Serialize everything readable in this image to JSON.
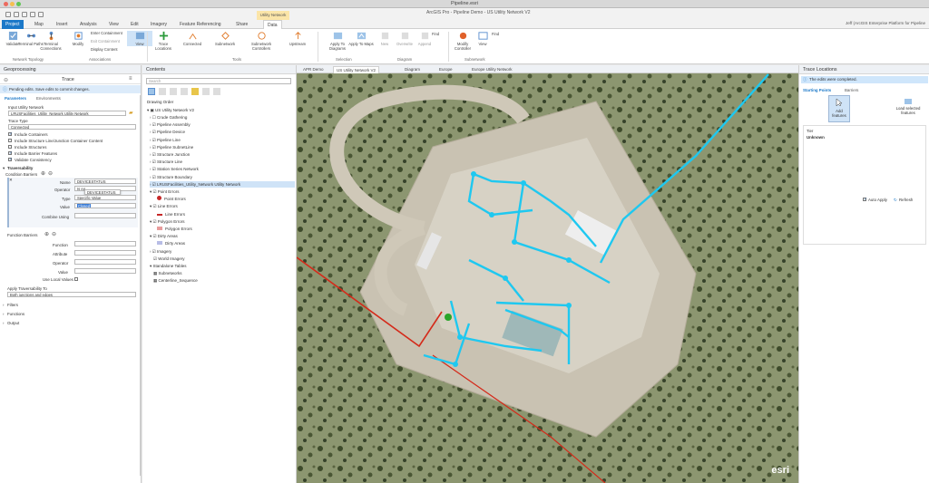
{
  "window": {
    "title": "Pipeline.esri",
    "app_center": "ArcGIS Pro - Pipeline Demo - US Utility Network V2",
    "context_tab_group": "Utility Network",
    "user": "Jeff (ArcGIS Enterprise Platform for Pipeline"
  },
  "ribbon": {
    "tabs": [
      "Project",
      "Map",
      "Insert",
      "Analysis",
      "View",
      "Edit",
      "Imagery",
      "Feature Referencing",
      "Share",
      "Data"
    ],
    "active_tab": "Data",
    "buttons": {
      "validate": "Validate",
      "terminal_paths": "Terminal Paths",
      "terminal_connections": "Terminal Connections",
      "modify": "Modify",
      "enter_containment": "Enter Containment",
      "exit_containment": "Exit Containment",
      "display_content": "Display Content",
      "view": "View",
      "trace_locations": "Trace Locations",
      "connected": "Connected",
      "subnetwork": "Subnetwork",
      "subnetwork_controllers": "Subnetwork Controllers",
      "upstream": "Upstream",
      "apply_to_diagrams": "Apply To Diagrams",
      "apply_to_maps": "Apply To Maps",
      "new": "New",
      "overwrite": "Overwrite",
      "append": "Append",
      "find_selection": "Find",
      "modify_controller": "Modify Controller",
      "view_subnetwork": "View",
      "find_subnetwork": "Find"
    },
    "groups": [
      "Network Topology",
      "Associations",
      "Tools",
      "Selection",
      "Diagram",
      "Subnetwork"
    ]
  },
  "geoprocessing": {
    "pane_title": "Geoprocessing",
    "tool_title": "Trace",
    "warning": "Pending edits. Save edits to commit changes.",
    "subtabs": [
      "Parameters",
      "Environments"
    ],
    "input_label": "Input Utility Network",
    "input_value": "LRUSFacilities_Utility_Network Utility Network",
    "trace_type_label": "Trace Type",
    "trace_type_value": "Connected",
    "options": [
      {
        "label": "Include Containers",
        "checked": true
      },
      {
        "label": "Include Structure Line/Junction Container Content",
        "checked": false
      },
      {
        "label": "Include Structures",
        "checked": false
      },
      {
        "label": "Include Barrier Features",
        "checked": true
      },
      {
        "label": "Validate Consistency",
        "checked": true
      }
    ],
    "traversability": "Traversability",
    "condition_barriers": "Condition Barriers",
    "name_label": "Name",
    "name_value": "DEVICESTATUS",
    "operator_label": "Operator",
    "operator_value": "Is eq",
    "dropdown_value": "DEVICESTATUS",
    "type_label": "Type",
    "type_value": "Specific Value",
    "value_label": "Value",
    "value_value": "Closed",
    "combine_label": "Combine Using",
    "function_barriers": "Function Barriers",
    "function_label": "Function",
    "attribute_label": "Attribute",
    "operator2_label": "Operator",
    "value2_label": "Value",
    "use_local_values": "Use Local Values",
    "apply_trav_label": "Apply Traversability To",
    "apply_trav_value": "Both junctions and edges",
    "sections": [
      "Filters",
      "Functions",
      "Output"
    ]
  },
  "contents": {
    "title": "Contents",
    "search_placeholder": "Search",
    "drawing_order": "Drawing Order",
    "map_name": "US Utility Network V2",
    "layers": [
      {
        "label": "Crude Gathering",
        "checked": false
      },
      {
        "label": "Pipeline Assembly",
        "checked": true
      },
      {
        "label": "Pipeline Device",
        "checked": true
      },
      {
        "label": "Pipeline Line",
        "checked": true
      },
      {
        "label": "Pipeline SubnetLine",
        "checked": true
      },
      {
        "label": "Structure Junction",
        "checked": true
      },
      {
        "label": "Structure Line",
        "checked": true
      },
      {
        "label": "Station Series Network",
        "checked": true
      },
      {
        "label": "Structure Boundary",
        "checked": true
      },
      {
        "label": "LRUSFacilities_Utility_Network Utility Network",
        "checked": true
      }
    ],
    "error_layers": [
      {
        "label": "Point Errors",
        "checked": true,
        "sym": "Point Errors",
        "sym_color": "#c62828"
      },
      {
        "label": "Line Errors",
        "checked": true,
        "sym": "Line Errors",
        "sym_color": "#c62828"
      },
      {
        "label": "Polygon Errors",
        "checked": true,
        "sym": "Polygon Errors",
        "sym_color": "#e89c9c"
      },
      {
        "label": "Dirty Areas",
        "checked": true,
        "sym": "Dirty Areas",
        "sym_color": "#b8bde6"
      }
    ],
    "imagery": "Imagery",
    "world_imagery": "World Imagery",
    "standalone_tables": "Standalone Tables",
    "tables": [
      "Subnetworks",
      "Centerline_Sequence"
    ]
  },
  "map_tabs": [
    "APR Demo",
    "US Utility Network V2",
    "Diagram",
    "Europe",
    "Europe Utility Network"
  ],
  "trace_locations": {
    "title": "Trace Locations",
    "banner": "The edits were completed.",
    "tabs": [
      "Starting Points",
      "Barriers"
    ],
    "add_features": "Add features",
    "load_selected": "Load selected features",
    "col_tier": "Tier",
    "col_value": "Unknown",
    "auto_apply": "Auto Apply",
    "refresh": "Refresh"
  },
  "watermark": "esri",
  "colors": {
    "accent": "#1b78c8",
    "trace": "#1ec8f0",
    "pipeline": "#d42a1a"
  }
}
